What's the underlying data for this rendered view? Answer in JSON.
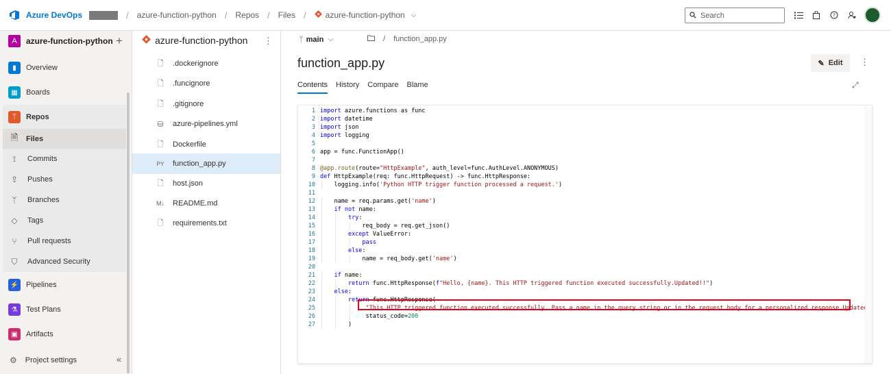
{
  "topbar": {
    "brand": "Azure DevOps",
    "breadcrumbs": [
      "azure-function-python",
      "Repos",
      "Files"
    ],
    "repo_crumb": "azure-function-python",
    "search_placeholder": "Search"
  },
  "leftnav": {
    "project_initial": "A",
    "project_name": "azure-function-python",
    "items": [
      {
        "label": "Overview",
        "icon": "overview-icon",
        "color": "#0078d4"
      },
      {
        "label": "Boards",
        "icon": "boards-icon",
        "color": "#009ccc"
      },
      {
        "label": "Repos",
        "icon": "repos-icon",
        "color": "#e05b2b"
      },
      {
        "label": "Files",
        "icon": "files-icon"
      },
      {
        "label": "Commits",
        "icon": "commits-icon"
      },
      {
        "label": "Pushes",
        "icon": "pushes-icon"
      },
      {
        "label": "Branches",
        "icon": "branches-icon"
      },
      {
        "label": "Tags",
        "icon": "tags-icon"
      },
      {
        "label": "Pull requests",
        "icon": "pull-requests-icon"
      },
      {
        "label": "Advanced Security",
        "icon": "shield-icon"
      },
      {
        "label": "Pipelines",
        "icon": "pipelines-icon",
        "color": "#2560e0"
      },
      {
        "label": "Test Plans",
        "icon": "test-plans-icon",
        "color": "#773adc"
      },
      {
        "label": "Artifacts",
        "icon": "artifacts-icon",
        "color": "#cc2d6f"
      }
    ],
    "settings_label": "Project settings"
  },
  "filetree": {
    "repo_name": "azure-function-python",
    "files": [
      {
        "name": ".dockerignore",
        "icon": "file-icon"
      },
      {
        "name": ".funcignore",
        "icon": "file-icon"
      },
      {
        "name": ".gitignore",
        "icon": "file-icon"
      },
      {
        "name": "azure-pipelines.yml",
        "icon": "yaml-icon"
      },
      {
        "name": "Dockerfile",
        "icon": "file-icon"
      },
      {
        "name": "function_app.py",
        "icon": "python-icon",
        "badge": "PY"
      },
      {
        "name": "host.json",
        "icon": "file-icon"
      },
      {
        "name": "README.md",
        "icon": "markdown-icon",
        "badge": "M↓"
      },
      {
        "name": "requirements.txt",
        "icon": "file-icon"
      }
    ]
  },
  "content": {
    "branch": "main",
    "path_file": "function_app.py",
    "title": "function_app.py",
    "edit_label": "Edit",
    "tabs": [
      "Contents",
      "History",
      "Compare",
      "Blame"
    ],
    "code": [
      "import azure.functions as func",
      "import datetime",
      "import json",
      "import logging",
      "",
      "app = func.FunctionApp()",
      "",
      "@app.route(route=\"HttpExample\", auth_level=func.AuthLevel.ANONYMOUS)",
      "def HttpExample(req: func.HttpRequest) -> func.HttpResponse:",
      "    logging.info('Python HTTP trigger function processed a request.')",
      "",
      "    name = req.params.get('name')",
      "    if not name:",
      "        try:",
      "            req_body = req.get_json()",
      "        except ValueError:",
      "            pass",
      "        else:",
      "            name = req_body.get('name')",
      "",
      "    if name:",
      "        return func.HttpResponse(f\"Hello, {name}. This HTTP triggered function executed successfully.Updated!!\")",
      "    else:",
      "        return func.HttpResponse(",
      "             \"This HTTP triggered function executed successfully. Pass a name in the query string or in the request body for a personalized response.Updated!!\",",
      "             status_code=200",
      "        )"
    ]
  },
  "colors": {
    "accent": "#0078d4",
    "keyword": "#0000ff",
    "string": "#a31515",
    "decorator": "#795e26",
    "number": "#098658",
    "highlight_border": "#e3001b"
  }
}
